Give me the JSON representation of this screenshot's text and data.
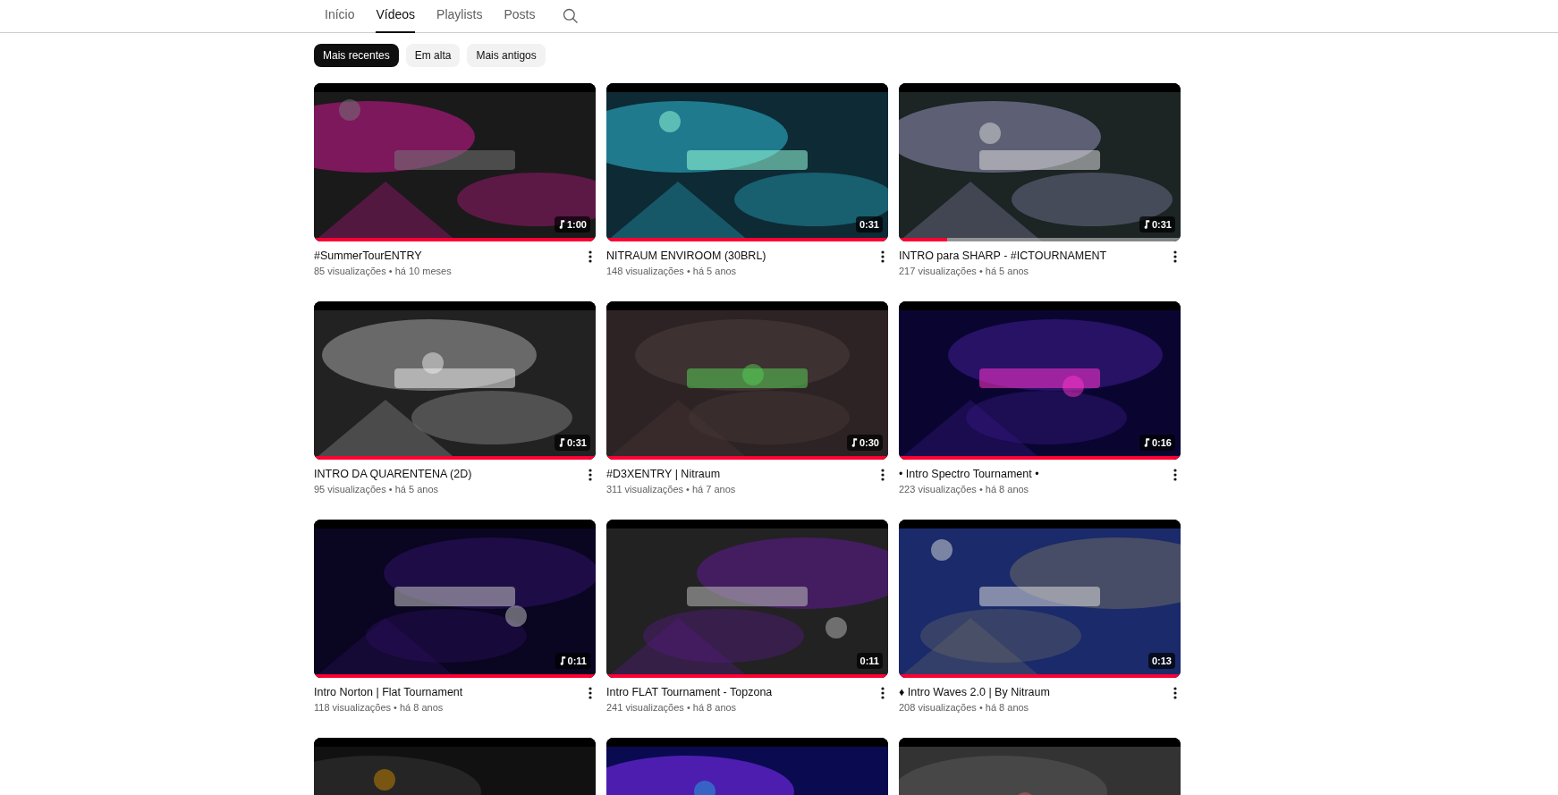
{
  "tabs": [
    {
      "label": "Início",
      "selected": false
    },
    {
      "label": "Vídeos",
      "selected": true
    },
    {
      "label": "Playlists",
      "selected": false
    },
    {
      "label": "Posts",
      "selected": false
    }
  ],
  "chips": [
    {
      "label": "Mais recentes",
      "selected": true
    },
    {
      "label": "Em alta",
      "selected": false
    },
    {
      "label": "Mais antigos",
      "selected": false
    }
  ],
  "videos": [
    {
      "title": "#SummerTourENTRY",
      "meta": "85 visualizações • há 10 meses",
      "duration": "1:00",
      "music": true,
      "level": 1
    },
    {
      "title": "NITRAUM ENVIROOM (30BRL)",
      "meta": "148 visualizações • há 5 anos",
      "duration": "0:31",
      "music": false,
      "level": 1
    },
    {
      "title": "INTRO para SHARP - #ICTOURNAMENT",
      "meta": "217 visualizações • há 5 anos",
      "duration": "0:31",
      "music": true,
      "level": 0.17
    },
    {
      "title": "INTRO DA QUARENTENA (2D)",
      "meta": "95 visualizações • há 5 anos",
      "duration": "0:31",
      "music": true,
      "level": 1
    },
    {
      "title": "#D3XENTRY | Nitraum",
      "meta": "311 visualizações • há 7 anos",
      "duration": "0:30",
      "music": true,
      "level": 1
    },
    {
      "title": "• Intro Spectro Tournament •",
      "meta": "223 visualizações • há 8 anos",
      "duration": "0:16",
      "music": true,
      "level": 1
    },
    {
      "title": "Intro Norton | Flat Tournament",
      "meta": "118 visualizações • há 8 anos",
      "duration": "0:11",
      "music": true,
      "level": 1
    },
    {
      "title": "Intro FLAT Tournament - Topzona",
      "meta": "241 visualizações • há 8 anos",
      "duration": "0:11",
      "music": false,
      "level": 1
    },
    {
      "title": "♦ Intro Waves 2.0 | By Nitraum",
      "meta": "208 visualizações • há 8 anos",
      "duration": "0:13",
      "music": false,
      "level": 1
    }
  ]
}
